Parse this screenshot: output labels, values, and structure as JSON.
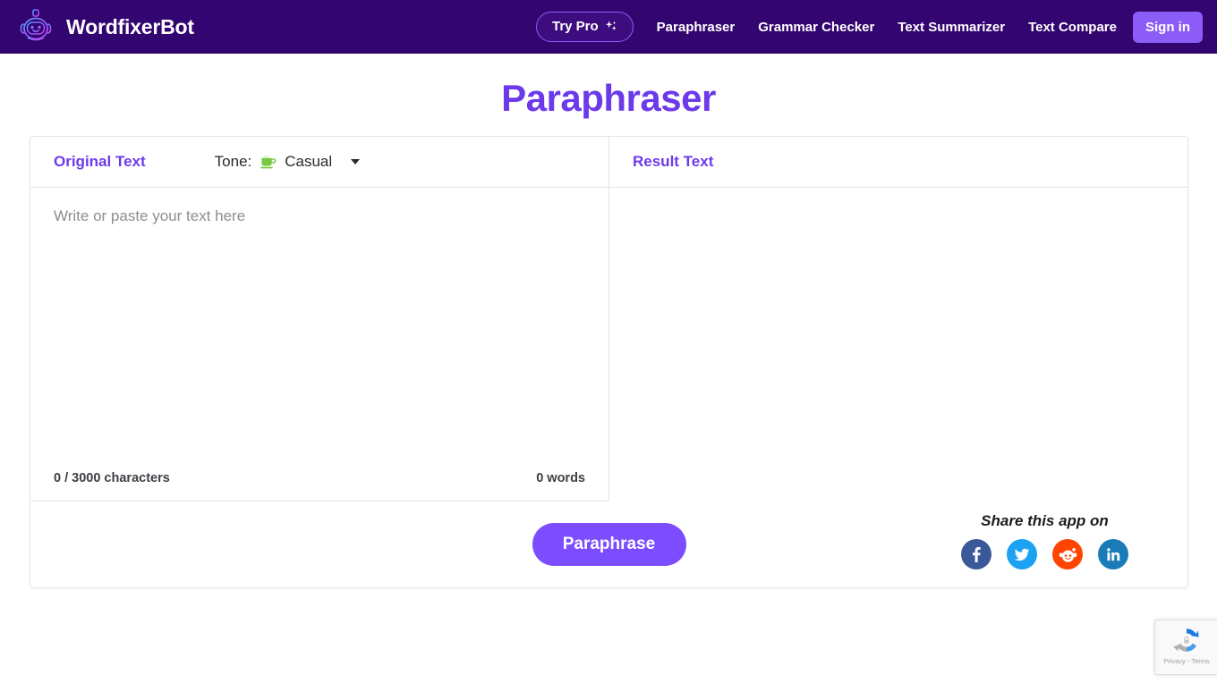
{
  "header": {
    "brand_name": "WordfixerBot",
    "logo_icon": "robot-head-icon",
    "try_pro": {
      "label": "Try Pro",
      "icon": "sparkles-icon"
    },
    "nav_links": [
      {
        "label": "Paraphraser"
      },
      {
        "label": "Grammar Checker"
      },
      {
        "label": "Text Summarizer"
      },
      {
        "label": "Text Compare"
      }
    ],
    "sign_in_label": "Sign in",
    "background_color": "#330570",
    "accent_color": "#8b5cf6"
  },
  "page": {
    "title": "Paraphraser",
    "title_color": "#6d3aeb"
  },
  "editor_panel": {
    "label": "Original Text",
    "tone": {
      "label": "Tone:",
      "icon": "coffee-cup-icon",
      "value": "Casual",
      "caret": "chevron-down-icon"
    },
    "placeholder": "Write or paste your text here",
    "value": "",
    "character_count": "0 / 3000 characters",
    "word_count": "0 words"
  },
  "result_panel": {
    "label": "Result Text",
    "value": ""
  },
  "footer": {
    "paraphrase_label": "Paraphrase",
    "paraphrase_color": "#7c4dff",
    "share_title": "Share this app on",
    "share_icons": [
      {
        "name": "facebook-share-icon",
        "color": "#3b5998"
      },
      {
        "name": "twitter-share-icon",
        "color": "#1da1f2"
      },
      {
        "name": "reddit-share-icon",
        "color": "#ff4500"
      },
      {
        "name": "linkedin-share-icon",
        "color": "#1a7bb9"
      }
    ]
  },
  "recaptcha": {
    "terms": "Privacy - Terms",
    "logo": "recaptcha-logo-icon"
  }
}
